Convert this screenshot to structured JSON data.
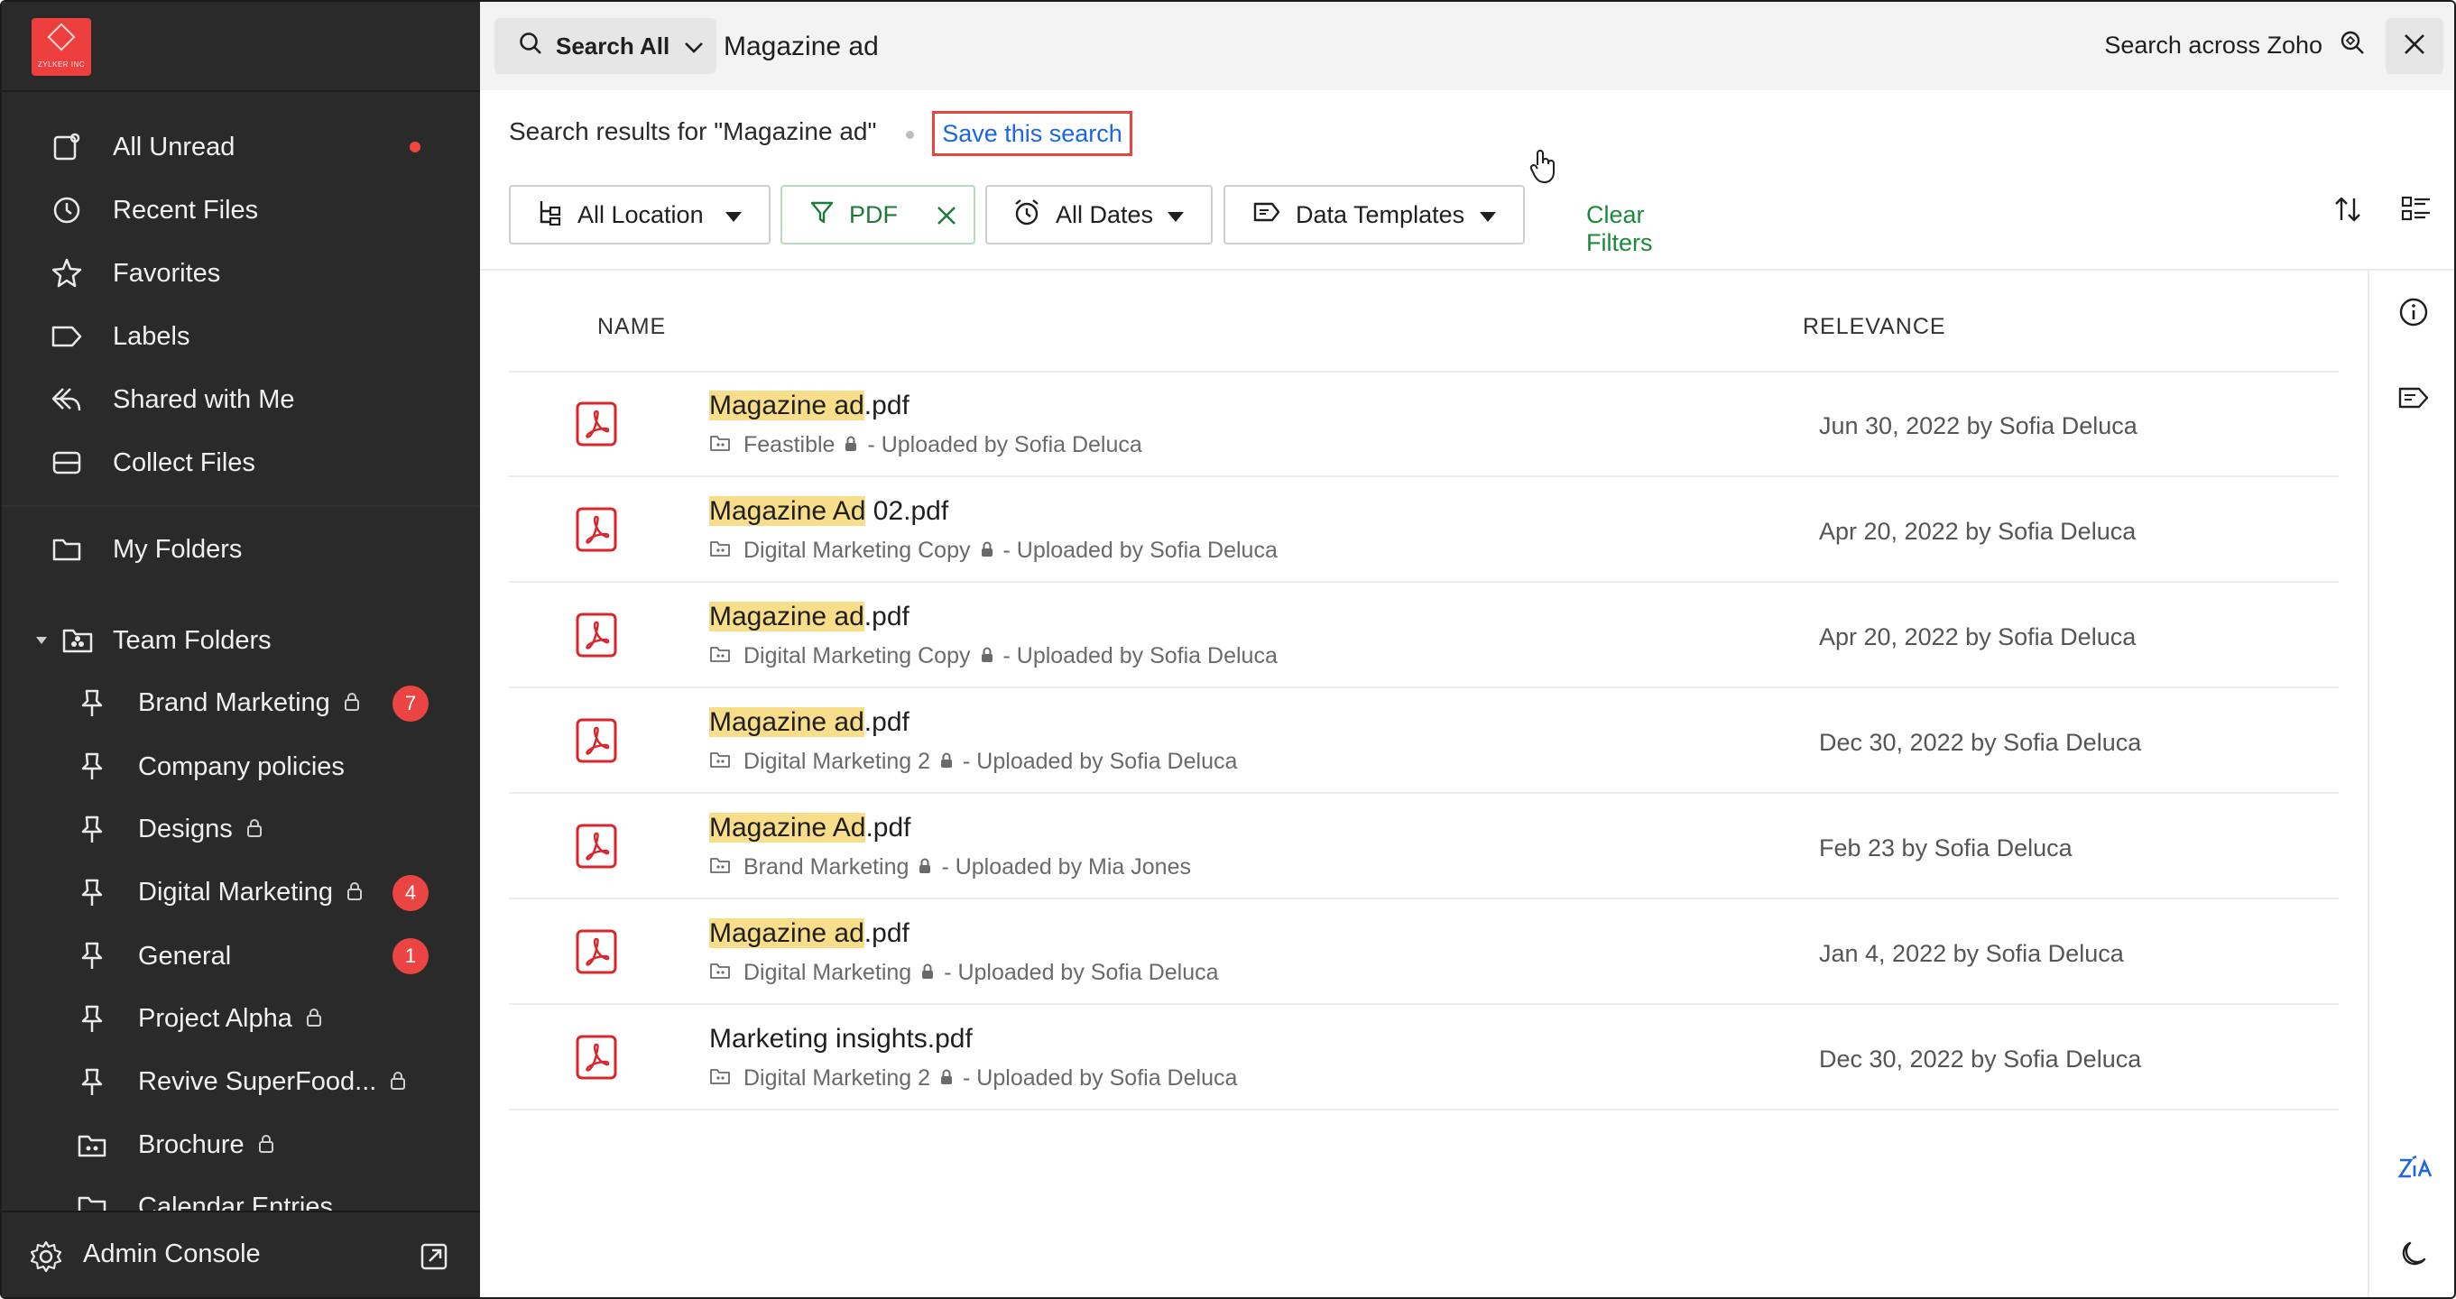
{
  "sidebar": {
    "logo_text": "ZYLKER INC",
    "nav": [
      {
        "label": "All Unread",
        "icon": "all-unread-icon"
      },
      {
        "label": "Recent Files",
        "icon": "clock-icon"
      },
      {
        "label": "Favorites",
        "icon": "star-icon"
      },
      {
        "label": "Labels",
        "icon": "label-icon"
      },
      {
        "label": "Shared with Me",
        "icon": "shared-icon"
      },
      {
        "label": "Collect Files",
        "icon": "collect-icon"
      },
      {
        "label": "My Folders",
        "icon": "folder-icon"
      }
    ],
    "team_folders_label": "Team Folders",
    "team_folders": [
      {
        "label": "Brand Marketing",
        "badge": "7"
      },
      {
        "label": "Company policies",
        "badge": ""
      },
      {
        "label": "Designs",
        "badge": ""
      },
      {
        "label": "Digital Marketing",
        "badge": "4"
      },
      {
        "label": "General",
        "badge": "1"
      },
      {
        "label": "Project Alpha",
        "badge": ""
      },
      {
        "label": "Revive SuperFood...",
        "badge": ""
      },
      {
        "label": "Brochure",
        "badge": ""
      },
      {
        "label": "Calendar Entries",
        "badge": ""
      }
    ],
    "footer_label": "Admin Console"
  },
  "search": {
    "scope_label": "Search All",
    "query": "Magazine ad",
    "across_label": "Search across Zoho"
  },
  "results": {
    "heading": "Search results for \"Magazine ad\"",
    "save_label": "Save this search"
  },
  "filters": {
    "location": "All Location",
    "type": "PDF",
    "dates": "All Dates",
    "templates": "Data Templates",
    "clear": "Clear Filters"
  },
  "table": {
    "col_name": "NAME",
    "col_relevance": "RELEVANCE",
    "rows": [
      {
        "hl": "Magazine ad",
        "rest": ".pdf",
        "folder": "Feastible",
        "uploader": "- Uploaded by Sofia Deluca",
        "date": "Jun 30, 2022 by Sofia Deluca"
      },
      {
        "hl": "Magazine Ad",
        "rest": " 02.pdf",
        "folder": "Digital Marketing Copy",
        "uploader": "- Uploaded by Sofia Deluca",
        "date": "Apr 20, 2022 by Sofia Deluca"
      },
      {
        "hl": "Magazine ad",
        "rest": ".pdf",
        "folder": "Digital Marketing Copy",
        "uploader": "- Uploaded by Sofia Deluca",
        "date": "Apr 20, 2022 by Sofia Deluca"
      },
      {
        "hl": "Magazine ad",
        "rest": ".pdf",
        "folder": "Digital Marketing 2",
        "uploader": "- Uploaded by Sofia Deluca",
        "date": "Dec 30, 2022 by Sofia Deluca"
      },
      {
        "hl": "Magazine Ad",
        "rest": ".pdf",
        "folder": "Brand Marketing",
        "uploader": "- Uploaded by Mia Jones",
        "date": "Feb 23 by Sofia Deluca"
      },
      {
        "hl": "Magazine ad",
        "rest": ".pdf",
        "folder": "Digital Marketing",
        "uploader": "- Uploaded by Sofia Deluca",
        "date": "Jan 4, 2022 by Sofia Deluca"
      },
      {
        "hl": "",
        "rest": "Marketing insights.pdf",
        "folder": "Digital Marketing 2",
        "uploader": "- Uploaded by Sofia Deluca",
        "date": "Dec 30, 2022 by Sofia Deluca"
      }
    ]
  },
  "colors": {
    "sidebar_bg": "#2a2a2a",
    "accent_red": "#ea4543",
    "link_blue": "#1a66e8",
    "filter_green": "#1a8a3a",
    "highlight": "#f8dd8a"
  }
}
